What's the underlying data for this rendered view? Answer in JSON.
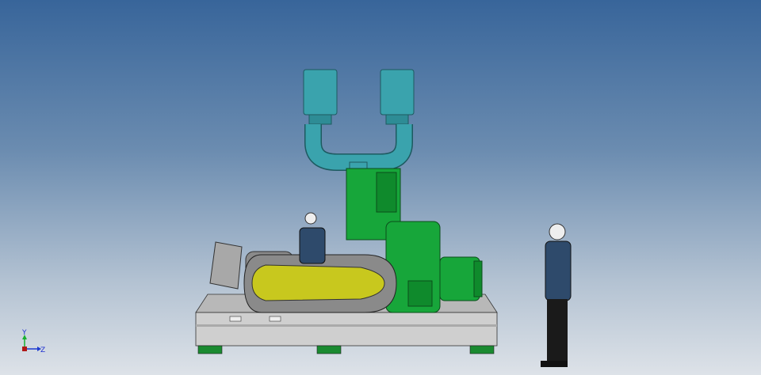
{
  "viewport": {
    "title": "3D model view"
  },
  "triad": {
    "y_label": "Y",
    "z_label": "Z"
  },
  "colors": {
    "machine": "#17a63a",
    "pipe": "#3aa3ad",
    "belt_guard": "#c8c81e",
    "frame": "#c9c9c9"
  }
}
